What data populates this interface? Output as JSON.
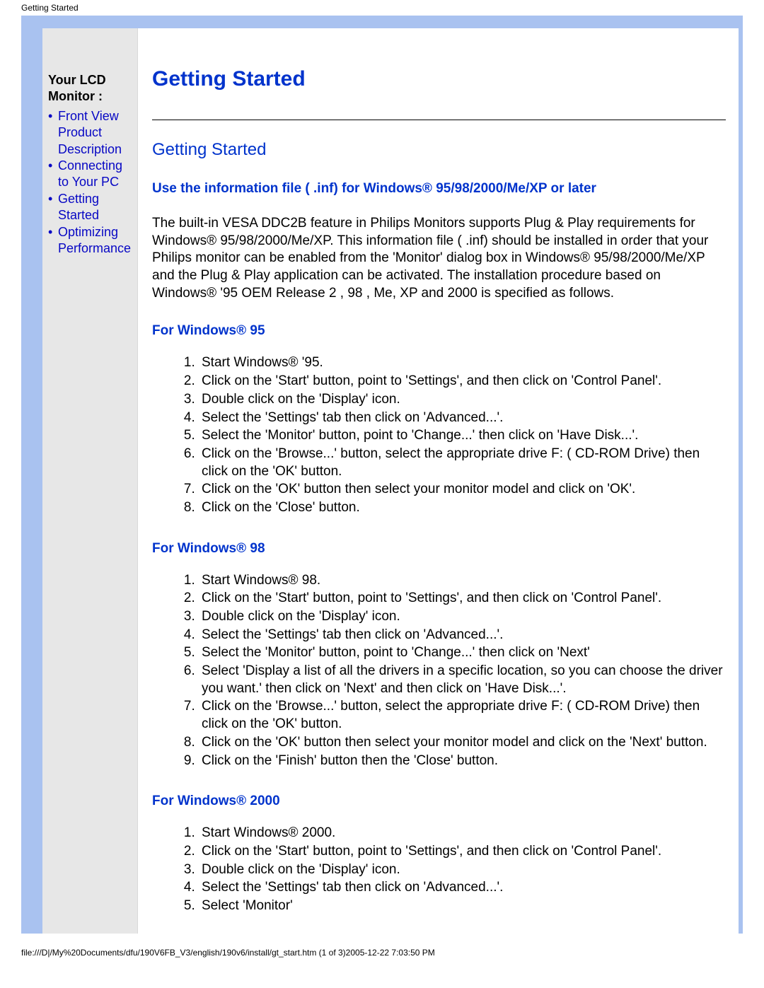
{
  "topLabel": "Getting Started",
  "sidebar": {
    "title": "Your LCD Monitor :",
    "items": [
      "Front View Product Description",
      "Connecting to Your PC",
      "Getting Started",
      "Optimizing Performance"
    ]
  },
  "page": {
    "title": "Getting Started",
    "subtitle": "Getting Started",
    "subhead": "Use the information file ( .inf) for Windows® 95/98/2000/Me/XP or later",
    "intro": "The built-in VESA DDC2B feature in Philips Monitors supports Plug & Play requirements for Windows® 95/98/2000/Me/XP. This information file ( .inf) should be installed in order that your Philips monitor can be enabled from the 'Monitor' dialog box in Windows® 95/98/2000/Me/XP and the Plug & Play application can be activated. The installation procedure based on Windows® '95 OEM Release 2 , 98 , Me, XP and 2000 is specified as follows."
  },
  "sections": [
    {
      "heading": "For Windows® 95",
      "steps": [
        "Start Windows® '95.",
        "Click on the 'Start' button, point to 'Settings', and then click on 'Control Panel'.",
        "Double click on the 'Display' icon.",
        "Select the 'Settings' tab then click on 'Advanced...'.",
        "Select the 'Monitor' button, point to 'Change...' then click on 'Have Disk...'.",
        "Click on the 'Browse...' button, select the appropriate drive F: ( CD-ROM Drive) then click on the 'OK' button.",
        "Click on the 'OK' button then select your monitor model and click on 'OK'.",
        "Click on the 'Close' button."
      ]
    },
    {
      "heading": "For Windows® 98",
      "steps": [
        "Start Windows® 98.",
        "Click on the 'Start' button, point to 'Settings', and then click on 'Control Panel'.",
        "Double click on the 'Display' icon.",
        "Select the 'Settings' tab then click on 'Advanced...'.",
        "Select the 'Monitor' button, point to 'Change...' then click on 'Next'",
        "Select 'Display a list of all the drivers in a specific location, so you can choose the driver you want.' then click on 'Next' and then click on 'Have Disk...'.",
        "Click on the 'Browse...' button, select the appropriate drive F: ( CD-ROM Drive) then click on the 'OK' button.",
        "Click on the 'OK' button then select your monitor model and click on the 'Next' button.",
        "Click on the 'Finish' button then the 'Close' button."
      ]
    },
    {
      "heading": "For Windows® 2000",
      "steps": [
        "Start Windows® 2000.",
        "Click on the 'Start' button, point to 'Settings', and then click on 'Control Panel'.",
        "Double click on the 'Display' icon.",
        "Select the 'Settings' tab then click on 'Advanced...'.",
        "Select 'Monitor'"
      ]
    }
  ],
  "footerPath": "file:///D|/My%20Documents/dfu/190V6FB_V3/english/190v6/install/gt_start.htm (1 of 3)2005-12-22 7:03:50 PM"
}
